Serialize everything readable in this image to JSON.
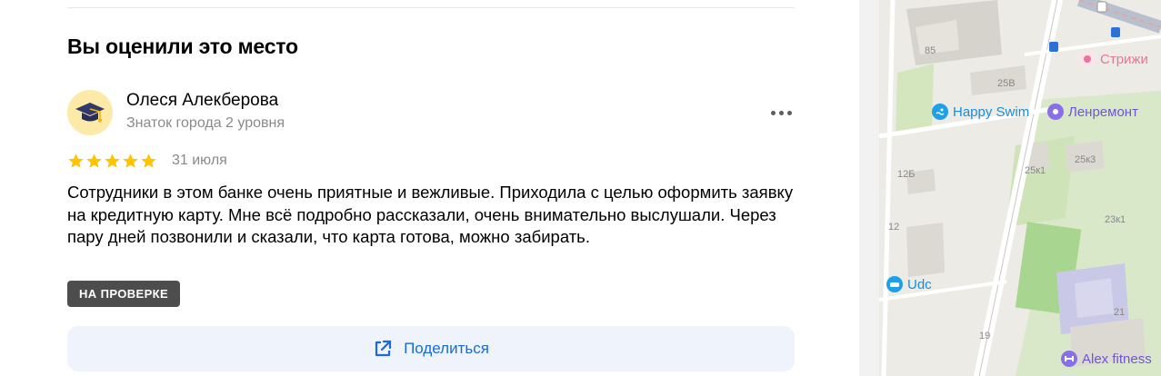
{
  "section": {
    "title": "Вы оценили это место"
  },
  "review": {
    "author": {
      "name": "Олеся Алекберова",
      "level": "Знаток города 2 уровня"
    },
    "rating": 5,
    "date": "31 июля",
    "text": "Сотрудники в этом банке очень приятные и вежливые. Приходила с целью оформить заявку на кредитную карту. Мне всё подробно рассказали, очень внимательно выслушали. Через пару дней позвонили и сказали, что карта готова, можно забирать.",
    "status": "НА ПРОВЕРКЕ"
  },
  "share": {
    "label": "Поделиться"
  },
  "colors": {
    "accent": "#1a6bd8",
    "star": "#fcc500",
    "badge": "#4d4d4d",
    "share_bg": "#eef3fc"
  },
  "map": {
    "pois": [
      {
        "name": "Стрижи",
        "icon": "flower-icon",
        "color": "#e8759a"
      },
      {
        "name": "Happy Swim",
        "icon": "swimmer-icon",
        "color": "#1ea0e8"
      },
      {
        "name": "Ленремонт",
        "icon": "service-icon",
        "color": "#8a6fe8"
      },
      {
        "name": "Udc",
        "icon": "car-icon",
        "color": "#1ea0e8"
      },
      {
        "name": "Alex fitness",
        "icon": "dumbbell-icon",
        "color": "#8a6fe8"
      }
    ],
    "house_numbers": [
      "85",
      "25В",
      "25к1",
      "25к3",
      "12Б",
      "12",
      "23к1",
      "21",
      "19"
    ]
  }
}
